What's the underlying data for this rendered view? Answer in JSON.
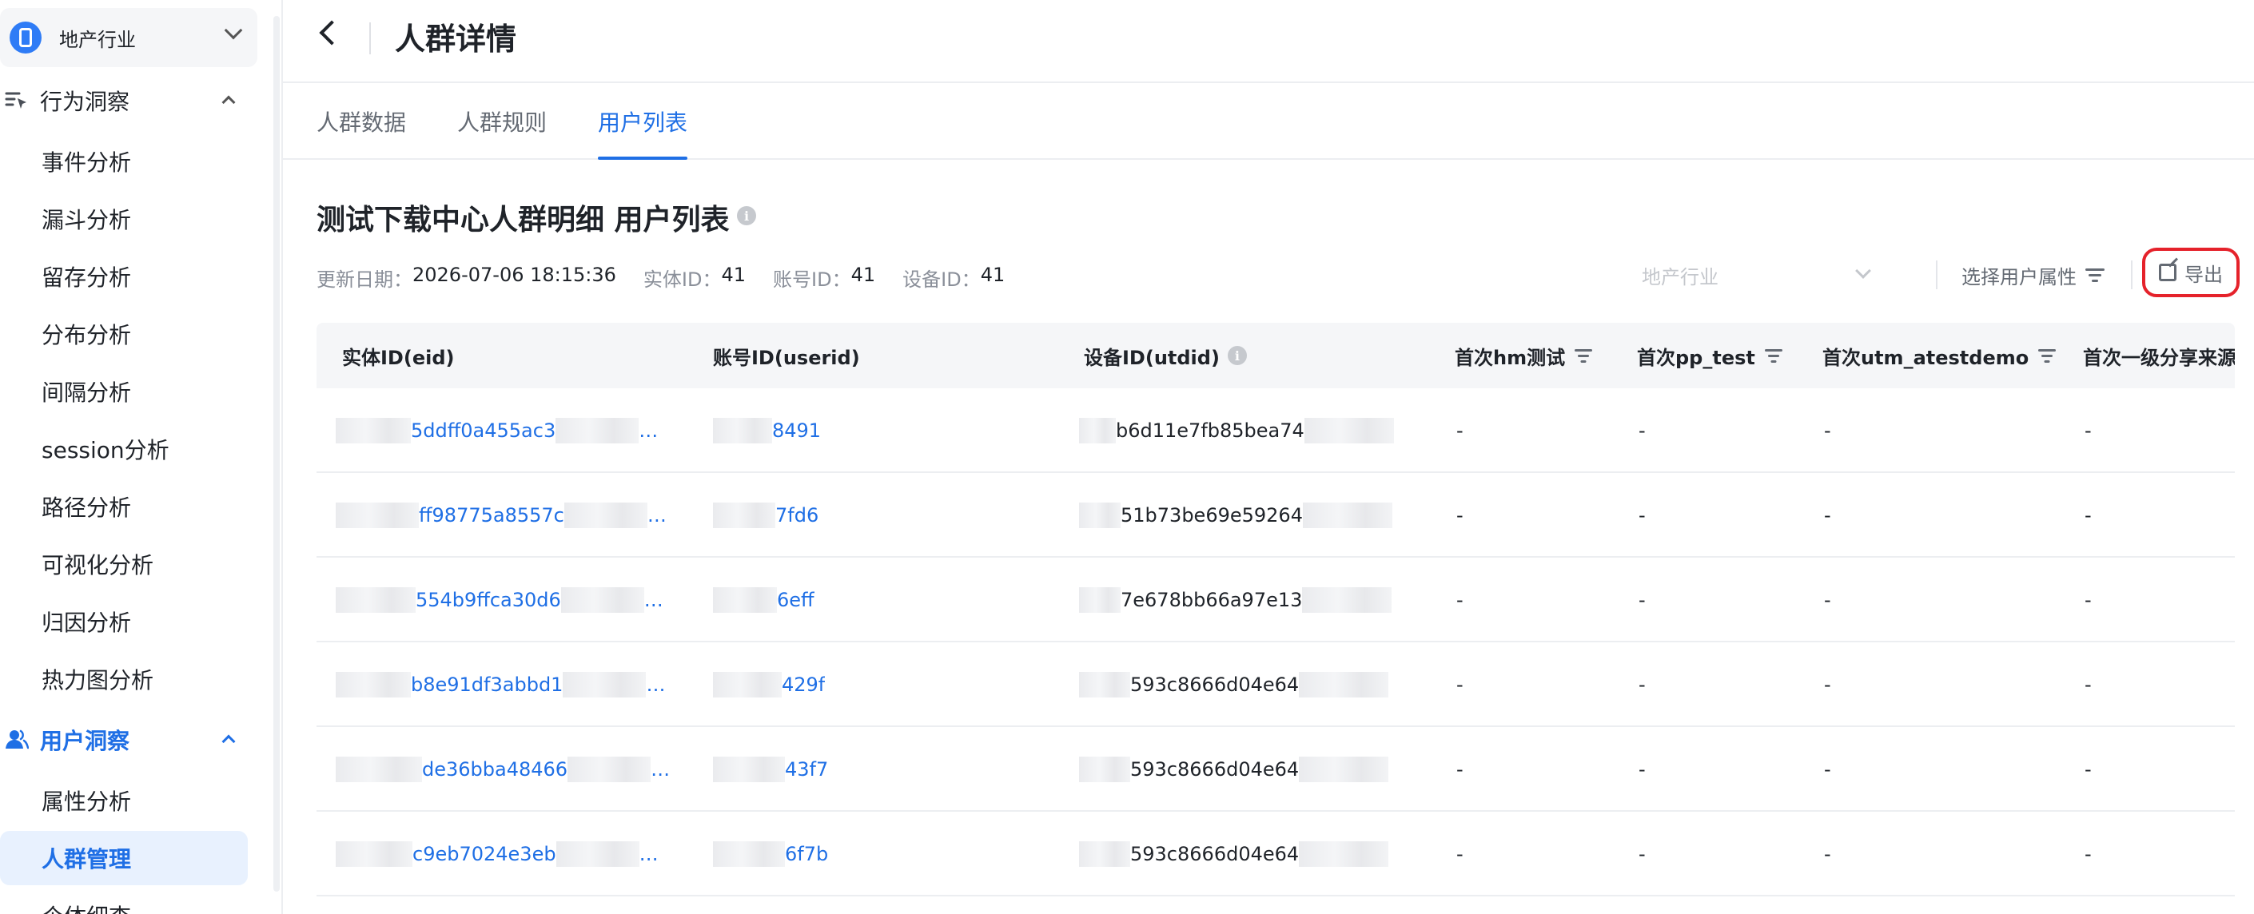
{
  "sidebar": {
    "industry": "地产行业",
    "groups": [
      {
        "label": "行为洞察",
        "items": [
          "事件分析",
          "漏斗分析",
          "留存分析",
          "分布分析",
          "间隔分析",
          "session分析",
          "路径分析",
          "可视化分析",
          "归因分析",
          "热力图分析"
        ]
      },
      {
        "label": "用户洞察",
        "items": [
          "属性分析",
          "人群管理",
          "个体细查"
        ]
      }
    ],
    "accent": "#1f6fe5"
  },
  "header": {
    "title": "人群详情"
  },
  "tabs": [
    "人群数据",
    "人群规则",
    "用户列表"
  ],
  "section": {
    "title": "测试下载中心人群明细 用户列表",
    "meta": {
      "update_label": "更新日期：",
      "update_value": "2026-07-06 18:15:36",
      "eid_label": "实体ID：",
      "eid_value": "41",
      "userid_label": "账号ID：",
      "userid_value": "41",
      "device_label": "设备ID：",
      "device_value": "41"
    }
  },
  "toolbar": {
    "industry_placeholder": "地产行业",
    "attr_label": "选择用户属性",
    "export_label": "导出",
    "export_highlight": "#e5222b"
  },
  "table": {
    "columns": [
      "实体ID(eid)",
      "账号ID(userid)",
      "设备ID(utdid)",
      "首次hm测试",
      "首次pp_test",
      "首次utm_atestdemo",
      "首次一级分享来源"
    ],
    "rows": [
      {
        "eid": "5ddff0a455ac3",
        "eid_tail": "…",
        "userid": "8491",
        "utdid": "b6d11e7fb85bea74",
        "c4": "-",
        "c5": "-",
        "c6": "-",
        "c7": "-"
      },
      {
        "eid": "ff98775a8557c",
        "eid_tail": "…",
        "userid": "7fd6",
        "utdid": "51b73be69e59264",
        "c4": "-",
        "c5": "-",
        "c6": "-",
        "c7": "-"
      },
      {
        "eid": "554b9ffca30d6",
        "eid_tail": "…",
        "userid": "6eff",
        "utdid": "7e678bb66a97e13",
        "c4": "-",
        "c5": "-",
        "c6": "-",
        "c7": "-"
      },
      {
        "eid": "b8e91df3abbd1",
        "eid_tail": "…",
        "userid": "429f",
        "utdid": "593c8666d04e64",
        "c4": "-",
        "c5": "-",
        "c6": "-",
        "c7": "-"
      },
      {
        "eid": "de36bba48466",
        "eid_tail": "…",
        "userid": "43f7",
        "utdid": "593c8666d04e64",
        "c4": "-",
        "c5": "-",
        "c6": "-",
        "c7": "-"
      },
      {
        "eid": "c9eb7024e3eb",
        "eid_tail": "…",
        "userid": "6f7b",
        "utdid": "593c8666d04e64",
        "c4": "-",
        "c5": "-",
        "c6": "-",
        "c7": "-"
      }
    ]
  }
}
